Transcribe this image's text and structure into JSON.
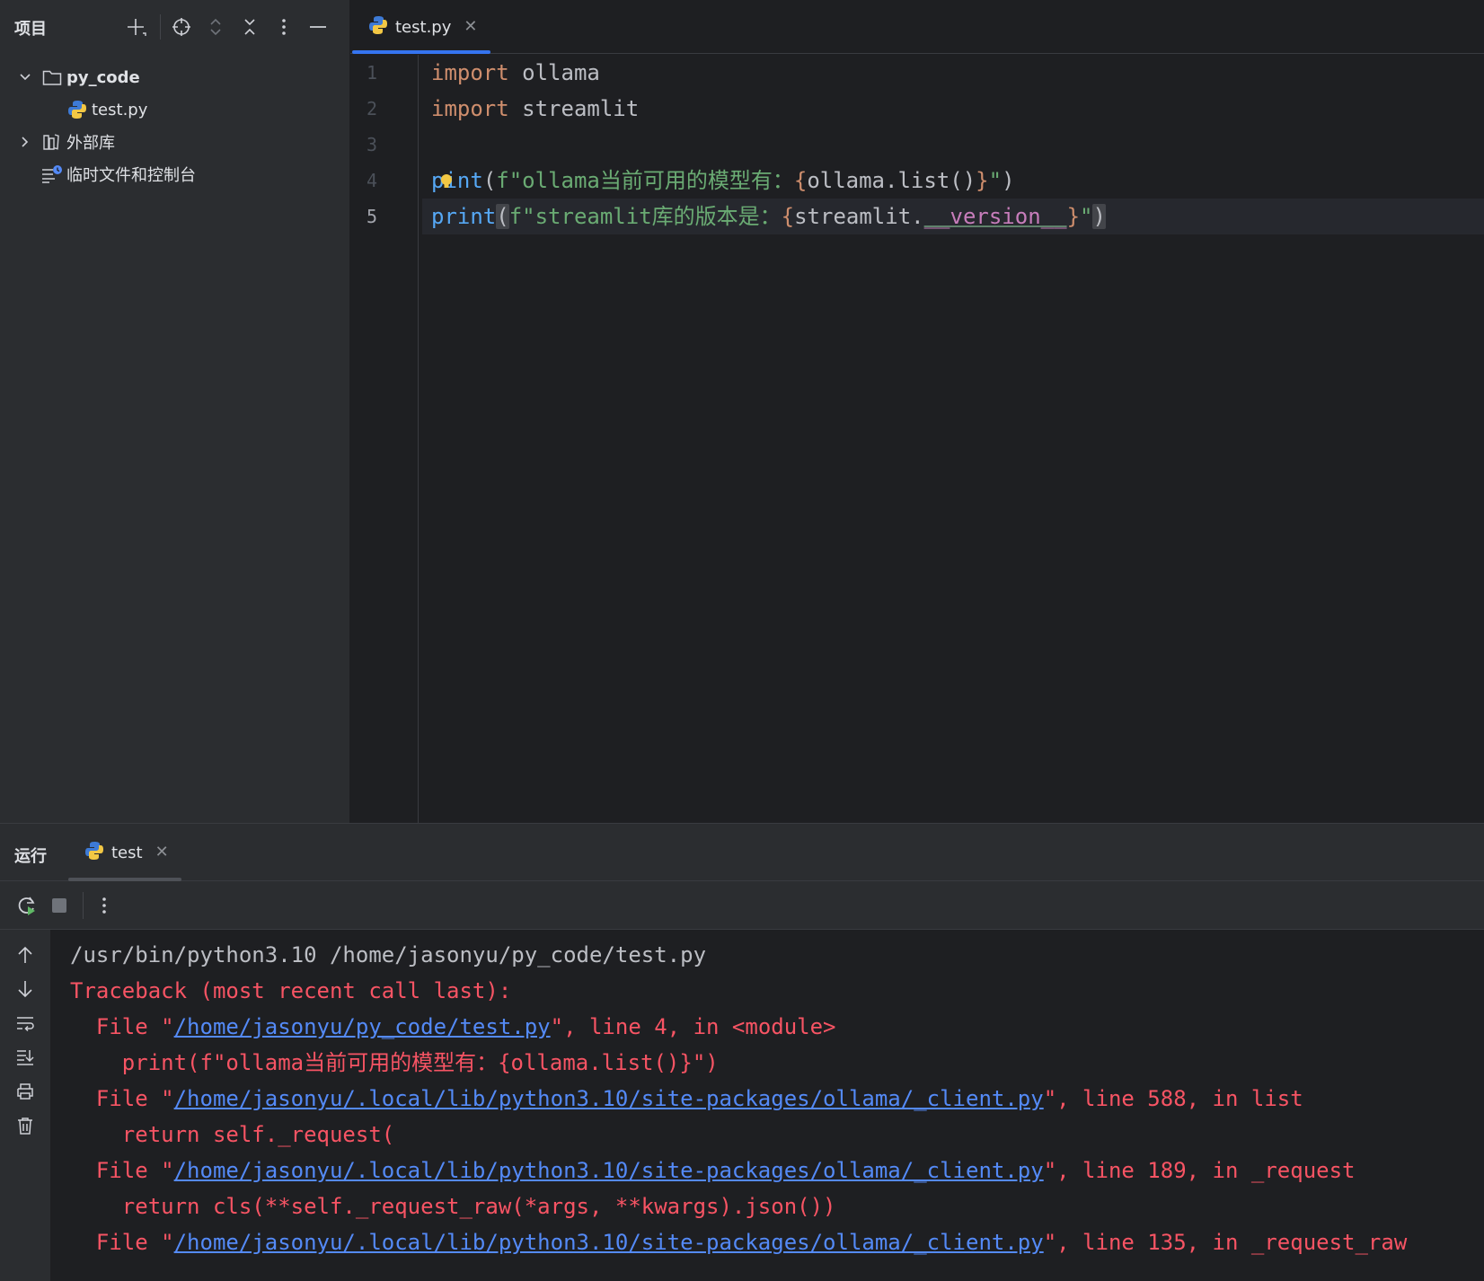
{
  "project_panel": {
    "title": "项目",
    "tree": [
      {
        "label": "py_code",
        "icon": "folder-icon",
        "expanded": true
      },
      {
        "label": "test.py",
        "icon": "python-file-icon"
      },
      {
        "label": "外部库",
        "icon": "library-icon",
        "expanded": false
      },
      {
        "label": "临时文件和控制台",
        "icon": "scratch-icon"
      }
    ]
  },
  "editor": {
    "tab": {
      "label": "test.py",
      "icon": "python-file-icon"
    },
    "line_numbers": [
      "1",
      "2",
      "3",
      "4",
      "5"
    ],
    "current_line": 5,
    "code": {
      "l1_kw": "import",
      "l1_rest": " ollama",
      "l2_kw": "import",
      "l2_rest": " streamlit",
      "l4_fn_a": "p",
      "l4_fn_b": "int",
      "l4_open": "(",
      "l4_str1": "f\"ollama当前可用的模型有：",
      "l4_brace_open": "{",
      "l4_expr": "ollama.list()",
      "l4_brace_close": "}",
      "l4_str2": "\"",
      "l4_close": ")",
      "l5_fn": "print",
      "l5_open": "(",
      "l5_str1": "f\"streamlit库的版本是：",
      "l5_brace_open": "{",
      "l5_expr": "streamlit.",
      "l5_dunder": "__version__",
      "l5_brace_close": "}",
      "l5_str2": "\"",
      "l5_close": ")"
    }
  },
  "run_panel": {
    "title": "运行",
    "tab": {
      "label": "test",
      "icon": "python-file-icon"
    },
    "console": {
      "cmd": "/usr/bin/python3.10 /home/jasonyu/py_code/test.py",
      "traceback": "Traceback (most recent call last):",
      "f1_pre": "  File \"",
      "f1_link": "/home/jasonyu/py_code/test.py",
      "f1_post": "\", line 4, in <module>",
      "f1_code": "    print(f\"ollama当前可用的模型有：{ollama.list()}\")",
      "f2_pre": "  File \"",
      "f2_link": "/home/jasonyu/.local/lib/python3.10/site-packages/ollama/_client.py",
      "f2_post": "\", line 588, in list",
      "f2_code": "    return self._request(",
      "f3_pre": "  File \"",
      "f3_link": "/home/jasonyu/.local/lib/python3.10/site-packages/ollama/_client.py",
      "f3_post": "\", line 189, in _request",
      "f3_code": "    return cls(**self._request_raw(*args, **kwargs).json())",
      "f4_pre": "  File \"",
      "f4_link": "/home/jasonyu/.local/lib/python3.10/site-packages/ollama/_client.py",
      "f4_post": "\", line 135, in _request_raw"
    }
  },
  "colors": {
    "accent": "#3574f0",
    "keyword": "#cf8e6d",
    "function": "#56a8f5",
    "string": "#6aab73",
    "error": "#f75464",
    "link": "#548af7"
  }
}
